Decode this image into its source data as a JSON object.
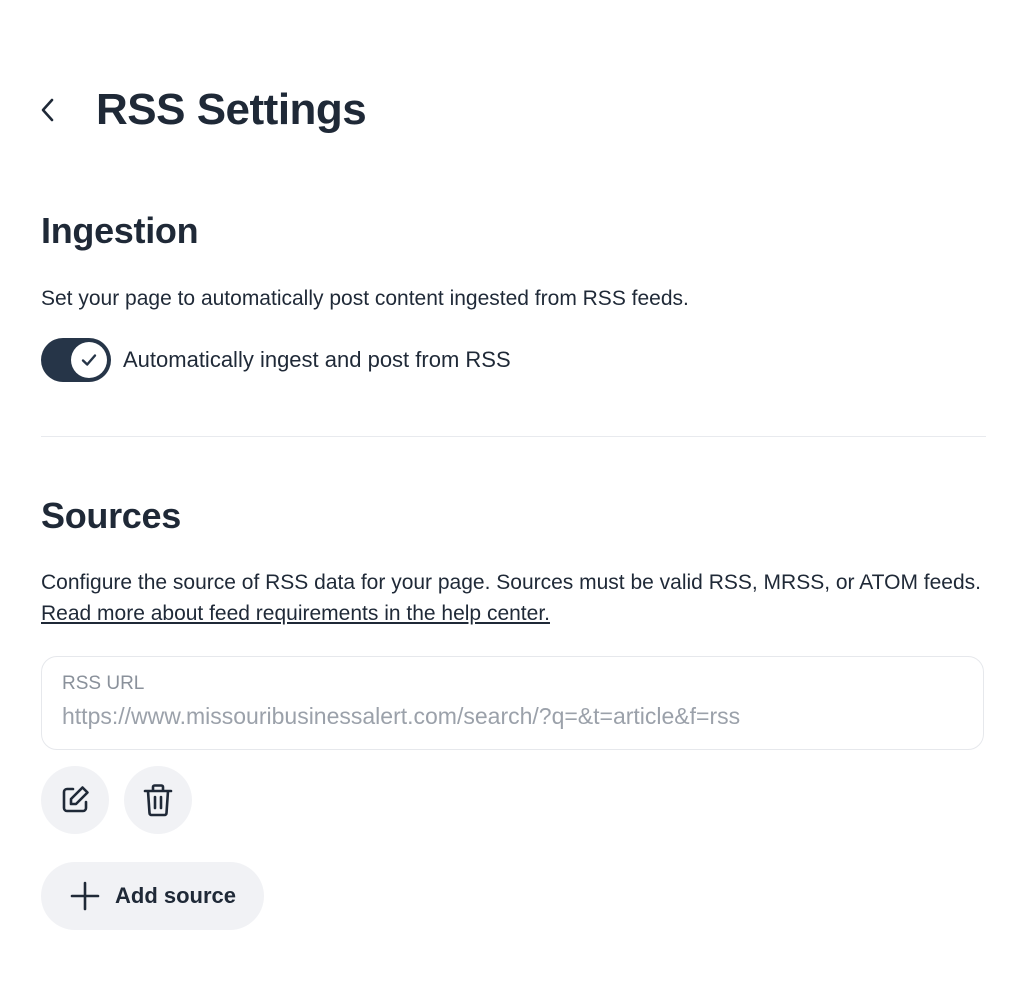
{
  "header": {
    "back_icon": "chevron-left-icon",
    "title": "RSS Settings"
  },
  "ingestion": {
    "title": "Ingestion",
    "description": "Set your page to automatically post content ingested from RSS feeds.",
    "toggle": {
      "label": "Automatically ingest and post from RSS",
      "checked": true,
      "icon": "check-icon"
    }
  },
  "sources": {
    "title": "Sources",
    "description": "Configure the source of RSS data for your page. Sources must be valid RSS, MRSS, or ATOM feeds.",
    "help_link": "Read more about feed requirements in the help center.",
    "items": [
      {
        "label": "RSS URL",
        "value": "https://www.missouribusinessalert.com/search/?q=&t=article&f=rss",
        "edit_icon": "edit-icon",
        "delete_icon": "trash-icon"
      }
    ],
    "add_button": {
      "label": "Add source",
      "icon": "plus-icon"
    }
  },
  "colors": {
    "text": "#1f2937",
    "toggle_on": "#263548",
    "button_bg": "#f1f2f5",
    "placeholder": "#9ba1aa",
    "border": "#e6e8ec"
  }
}
